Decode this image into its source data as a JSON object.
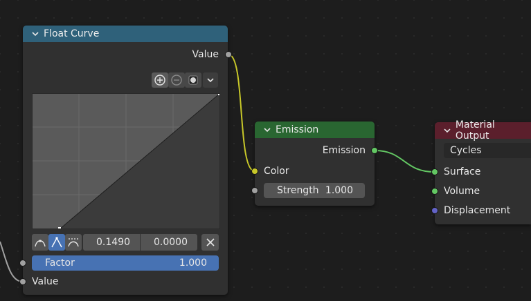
{
  "nodes": {
    "float_curve": {
      "title": "Float Curve",
      "output_value_label": "Value",
      "point_x": "0.1490",
      "point_y": "0.0000",
      "factor_label": "Factor",
      "factor_value": "1.000",
      "factor_fraction": 1.0,
      "input_value_label": "Value",
      "header_color": "#2f617a"
    },
    "emission": {
      "title": "Emission",
      "output_label": "Emission",
      "color_label": "Color",
      "strength_label": "Strength",
      "strength_value": "1.000",
      "header_color": "#296631"
    },
    "material_output": {
      "title": "Material Output",
      "target_value": "Cycles",
      "surface_label": "Surface",
      "volume_label": "Volume",
      "displacement_label": "Displacement",
      "header_color": "#5b1f2c"
    }
  },
  "icons": {
    "zoom_in": "zoom-in-icon",
    "zoom_out": "zoom-out-icon",
    "clip": "clipping-icon",
    "dropdown": "chevron-down-icon",
    "handle_auto": "auto-handle-icon",
    "handle_vector": "vector-handle-icon",
    "handle_clamped": "clamped-handle-icon",
    "delete": "close-icon"
  },
  "colors": {
    "wire_color": "#c7c729",
    "wire_green": "#63c763",
    "socket_float": "#a1a1a1",
    "socket_shader": "#63c763",
    "socket_vector": "#6363c7",
    "accent_blue": "#4772b3"
  }
}
